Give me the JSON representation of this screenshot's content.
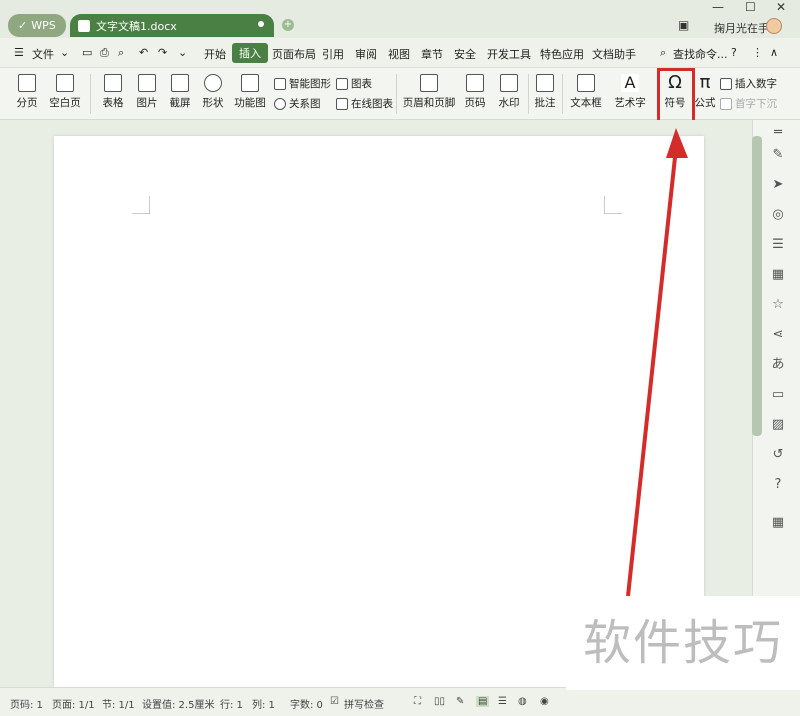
{
  "titlebar": {
    "wps_label": "WPS",
    "doc_tab_label": "文字文稿1.docx",
    "user_name": "掬月光在手"
  },
  "menu": {
    "file": "文件",
    "tabs": [
      "开始",
      "插入",
      "页面布局",
      "引用",
      "审阅",
      "视图",
      "章节",
      "安全",
      "开发工具",
      "特色应用",
      "文档助手"
    ],
    "active_tab": "插入",
    "search_placeholder": "查找命令..."
  },
  "ribbon": {
    "items": [
      "分页",
      "空白页",
      "表格",
      "图片",
      "截屏",
      "形状",
      "功能图",
      "智能图形",
      "图表",
      "关系图",
      "在线图表",
      "页眉和页脚",
      "页码",
      "水印",
      "批注",
      "文本框",
      "艺术字",
      "符号",
      "公式",
      "插入数字",
      "首字下沉"
    ]
  },
  "status_bar": {
    "page": "页码: 1",
    "pages": "页面: 1/1",
    "section": "节: 1/1",
    "setting": "设置值: 2.5厘米",
    "row": "行: 1",
    "col": "列: 1",
    "words": "字数: 0",
    "spellcheck": "拼写检查"
  },
  "watermark": "软件技巧",
  "colors": {
    "accent": "#4a8043",
    "highlight": "#d42b2b"
  }
}
